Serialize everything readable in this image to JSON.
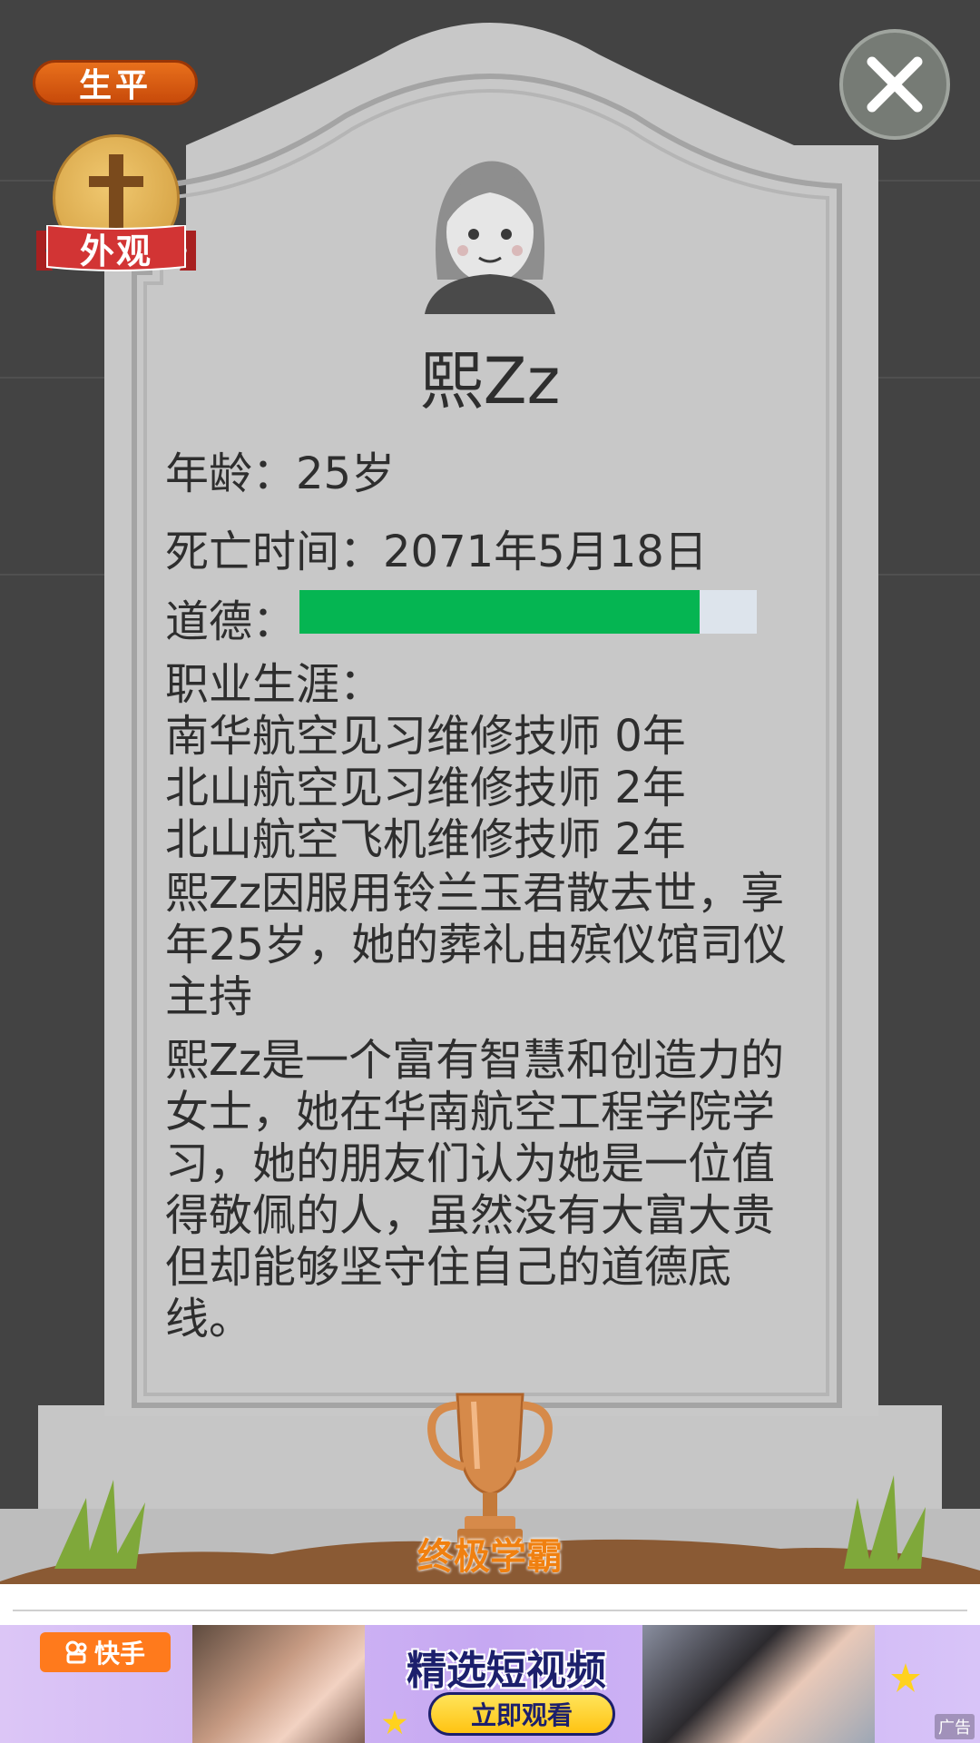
{
  "header": {
    "lifetime_label": "生平",
    "appearance_label": "外观",
    "close_icon": "close-icon"
  },
  "profile": {
    "name": "熙Zz",
    "age_line": "年龄：25岁",
    "death_time_line": "死亡时间：2071年5月18日",
    "morality_label": "道德：",
    "morality_level": 0.875,
    "career_label": "职业生涯：",
    "careers": [
      "南华航空见习维修技师 0年",
      "北山航空见习维修技师 2年",
      "北山航空飞机维修技师 2年"
    ],
    "death_description": "熙Zz因服用铃兰玉君散去世，享年25岁，她的葬礼由殡仪馆司仪主持",
    "biography": "熙Zz是一个富有智慧和创造力的女士，她在华南航空工程学院学习，她的朋友们认为她是一位值得敬佩的人，虽然没有大富大贵但却能够坚守住自己的道德底线。"
  },
  "achievement": {
    "title": "终极学霸",
    "icon": "trophy-icon"
  },
  "ad": {
    "brand": "快手",
    "headline": "精选短视频",
    "cta": "立即观看",
    "tag": "广告"
  },
  "colors": {
    "background": "#434343",
    "tombstone": "#c4c4c4",
    "morality_fill": "#05b552",
    "lifetime_button": "#d85a12",
    "achievement_text": "#f08010"
  }
}
